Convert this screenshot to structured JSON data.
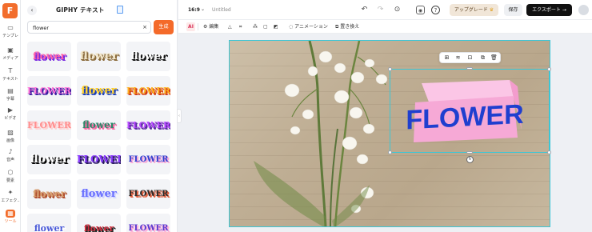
{
  "app": {
    "logo_letter": "F"
  },
  "rail": [
    {
      "name": "templates",
      "label": "テンプレ",
      "color": "#444"
    },
    {
      "name": "media",
      "label": "メディア",
      "color": "#444"
    },
    {
      "name": "text",
      "label": "テキスト",
      "color": "#444"
    },
    {
      "name": "subtitles",
      "label": "字幕",
      "color": "#444"
    },
    {
      "name": "video",
      "label": "ビデオ",
      "color": "#444"
    },
    {
      "name": "images",
      "label": "画像",
      "color": "#444"
    },
    {
      "name": "audio",
      "label": "音声",
      "color": "#444"
    },
    {
      "name": "elements",
      "label": "要素",
      "color": "#444"
    },
    {
      "name": "effects",
      "label": "エフェク..",
      "color": "#444"
    },
    {
      "name": "tools",
      "label": "ツール",
      "color": "#f26d2c"
    }
  ],
  "panel": {
    "title": "GIPHY テキスト",
    "search": {
      "value": "flower",
      "placeholder": ""
    },
    "generate_label": "生成",
    "tiles": [
      {
        "text": "flower",
        "fg": "#ff5fa8",
        "shadow": "#7a2be0",
        "size": 9
      },
      {
        "text": "flower",
        "fg": "#f2e6c8",
        "shadow": "#8a6a3a",
        "size": 11
      },
      {
        "text": "flower",
        "fg": "#ffffff",
        "shadow": "#111111",
        "size": 10
      },
      {
        "text": "FLOWER",
        "fg": "#ff6fd8",
        "shadow": "#3a1aa0",
        "size": 8
      },
      {
        "text": "flower",
        "fg": "#ffd02a",
        "shadow": "#1b3fb8",
        "size": 10
      },
      {
        "text": "FLOWER",
        "fg": "#ffb020",
        "shadow": "#d23a10",
        "size": 8
      },
      {
        "text": "FLOWER",
        "fg": "#ff8f8f",
        "shadow": "#ffd0d0",
        "size": 8
      },
      {
        "text": "flower",
        "fg": "#2b8a6a",
        "shadow": "#f06aa0",
        "size": 9
      },
      {
        "text": "FLOWER",
        "fg": "#b84cff",
        "shadow": "#5a2aa0",
        "size": 8
      },
      {
        "text": "flower",
        "fg": "#ffffff",
        "shadow": "#000000",
        "size": 11
      },
      {
        "text": "FLOWER",
        "fg": "#8a3aff",
        "shadow": "#2a1a60",
        "size": 9
      },
      {
        "text": "FLOWER",
        "fg": "#3040d0",
        "shadow": "#f7a8d8",
        "size": 7
      },
      {
        "text": "flower",
        "fg": "#d8a070",
        "shadow": "#b05030",
        "size": 9
      },
      {
        "text": "flower",
        "fg": "#6a70ff",
        "shadow": "#d0d4ff",
        "size": 10
      },
      {
        "text": "FLOWER",
        "fg": "#2a2a2a",
        "shadow": "#e06040",
        "size": 7
      },
      {
        "text": "flower",
        "fg": "#4a5ad8",
        "shadow": "#ffffff",
        "size": 8
      },
      {
        "text": "flower",
        "fg": "#d03040",
        "shadow": "#222222",
        "size": 8
      },
      {
        "text": "FLOWER",
        "fg": "#5a3ad0",
        "shadow": "#ffb0d8",
        "size": 7
      }
    ]
  },
  "topbar": {
    "ratio": "16:9",
    "doc_name": "Untitled",
    "upgrade_label": "アップグレード",
    "save_label": "保存",
    "export_label": "エクスポート →"
  },
  "toolbar": {
    "ai_label": "AI",
    "edit_label": "編集",
    "animation_label": "アニメーション",
    "replace_label": "置き換え"
  },
  "canvas": {
    "text": "FLOWER",
    "text_color": "#1f3fcf",
    "block_color": "#f6a9d6",
    "selection_color": "#3cc6d6"
  }
}
